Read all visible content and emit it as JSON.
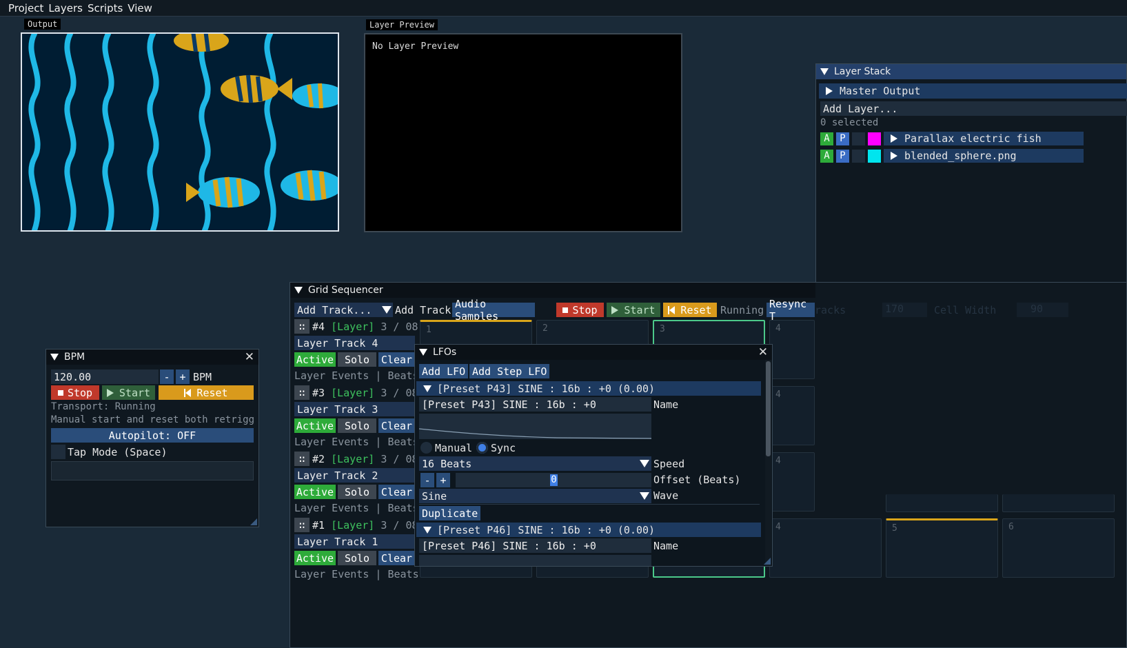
{
  "menu": [
    "Project",
    "Layers",
    "Scripts",
    "View"
  ],
  "output_label": "Output",
  "preview": {
    "label": "Layer Preview",
    "empty_text": "No Layer Preview"
  },
  "bpm": {
    "title": "BPM",
    "value": "120.00",
    "minus": "-",
    "plus": "+",
    "unit": "BPM",
    "stop": "Stop",
    "start": "Start",
    "reset": "Reset",
    "transport": "Transport: Running",
    "note": "Manual start and reset both retrigg",
    "autopilot": "Autopilot: OFF",
    "tap_mode": "Tap Mode (Space)"
  },
  "layer_stack": {
    "title": "Layer Stack",
    "master": "Master Output",
    "add_layer": "Add Layer...",
    "selected": "0 selected",
    "layers": [
      {
        "a": "A",
        "p": "P",
        "color": "#ff00ff",
        "name": "Parallax electric fish"
      },
      {
        "a": "A",
        "p": "P",
        "color": "#00e5ee",
        "name": "blended_sphere.png"
      }
    ]
  },
  "sequencer": {
    "title": "Grid Sequencer",
    "add_track_combo": "Add Track...",
    "add_track": "Add Track",
    "audio_samples": "Audio Samples",
    "stop": "Stop",
    "start": "Start",
    "reset": "Reset",
    "status": "Running",
    "resync": "Resync T",
    "tracks_label": "racks",
    "tracks_value": "170",
    "cell_width_label": "Cell Width",
    "cell_width_value": "90",
    "tracks": [
      {
        "num": "#4",
        "type": "[Layer]",
        "pos": "3 / 08",
        "name": "Layer Track 4",
        "active": "Active",
        "solo": "Solo",
        "clear": "Clear",
        "events": "Layer Events | Beats"
      },
      {
        "num": "#3",
        "type": "[Layer]",
        "pos": "3 / 08",
        "name": "Layer Track 3",
        "active": "Active",
        "solo": "Solo",
        "clear": "Clear",
        "events": "Layer Events | Beats"
      },
      {
        "num": "#2",
        "type": "[Layer]",
        "pos": "3 / 08",
        "name": "Layer Track 2",
        "active": "Active",
        "solo": "Solo",
        "clear": "Clear",
        "events": "Layer Events | Beats"
      },
      {
        "num": "#1",
        "type": "[Layer]",
        "pos": "3 / 08",
        "name": "Layer Track 1",
        "active": "Active",
        "solo": "Solo",
        "clear": "Clear",
        "events": "Layer Events | Beats"
      }
    ],
    "cell_numbers": {
      "c1": "1",
      "c2": "2",
      "c3": "3",
      "c4": "4",
      "c5": "5",
      "c6": "6"
    }
  },
  "lfos": {
    "title": "LFOs",
    "add_lfo": "Add LFO",
    "add_step_lfo": "Add Step LFO",
    "items": [
      {
        "header": "[Preset P43] SINE : 16b : +0 (0.00)",
        "name_value": "[Preset P43] SINE : 16b : +0",
        "name_label": "Name",
        "manual": "Manual",
        "sync": "Sync",
        "speed_value": "16 Beats",
        "speed_label": "Speed",
        "offset_value": "0",
        "offset_label": "Offset (Beats)",
        "wave_value": "Sine",
        "wave_label": "Wave",
        "duplicate": "Duplicate"
      },
      {
        "header": "[Preset P46] SINE : 16b : +0 (0.00)",
        "name_value": "[Preset P46] SINE : 16b : +0",
        "name_label": "Name"
      }
    ]
  }
}
